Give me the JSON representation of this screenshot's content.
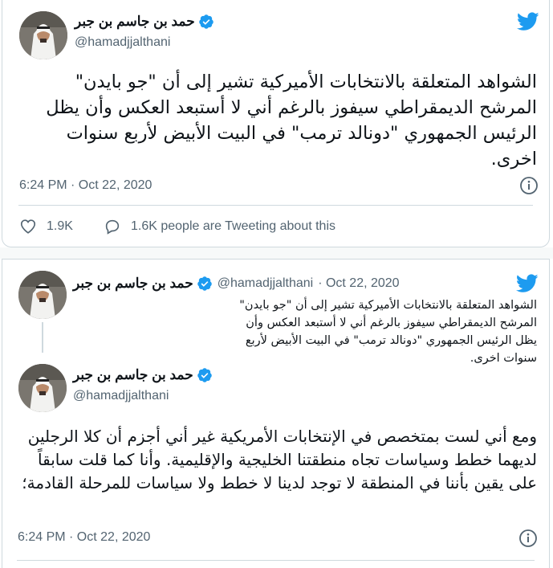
{
  "tweet1": {
    "display_name": "حمد بن جاسم بن جبر",
    "handle": "@hamadjjalthani",
    "text": "الشواهد المتعلقة بالانتخابات الأميركية تشير إلى أن \"جو بايدن\" المرشح الديمقراطي سيفوز بالرغم أني لا أستبعد العكس وأن يظل الرئيس الجمهوري \"دونالد ترمب\" في البيت الأبيض لأربع سنوات اخرى.",
    "timestamp": "6:24 PM · Oct 22, 2020",
    "likes": "1.9K",
    "replies_text": "1.6K people are Tweeting about this"
  },
  "tweet2_quoted": {
    "display_name": "حمد بن جاسم بن جبر",
    "handle": "@hamadjjalthani",
    "date": "· Oct 22, 2020",
    "text": "الشواهد المتعلقة بالانتخابات الأميركية تشير إلى أن \"جو بايدن\" المرشح الديمقراطي سيفوز بالرغم أني لا أستبعد العكس وأن يظل الرئيس الجمهوري \"دونالد ترمب\" في البيت الأبيض لأربع سنوات اخرى."
  },
  "tweet2_main": {
    "display_name": "حمد بن جاسم بن جبر",
    "handle": "@hamadjjalthani",
    "text": "ومع أني لست بمتخصص في الإنتخابات الأمريكية غير أني  أجزم أن كلا الرجلين لديهما خطط وسياسات تجاه منطقتنا الخليجية والإقليمية. وأنا كما قلت سابقاً على يقين بأننا في المنطقة لا توجد لدينا لا خطط ولا سياسات للمرحلة القادمة؛",
    "timestamp": "6:24 PM · Oct 22, 2020"
  },
  "icons": {
    "logo": "twitter-bird-icon",
    "verified": "verified-badge-icon",
    "info": "info-icon",
    "like": "heart-icon",
    "reply": "speech-bubble-icon"
  },
  "colors": {
    "twitter_blue": "#1d9bf0",
    "text": "#0f1419",
    "muted": "#536471",
    "border": "#cfd9de"
  }
}
